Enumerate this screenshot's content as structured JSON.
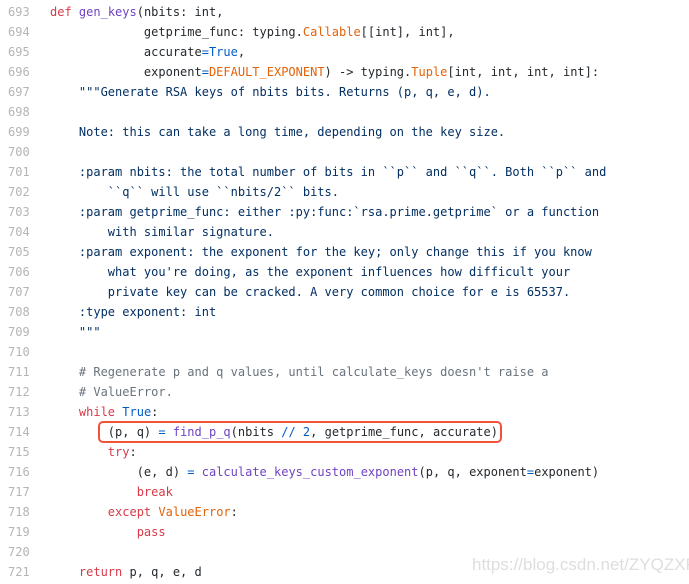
{
  "code": {
    "lines": [
      {
        "n": "693",
        "tokens": [
          [
            "kw",
            "def"
          ],
          [
            "tx",
            " "
          ],
          [
            "fn",
            "gen_keys"
          ],
          [
            "tx",
            "(nbits: int,"
          ]
        ]
      },
      {
        "n": "694",
        "tokens": [
          [
            "tx",
            "             getprime_func: typing."
          ],
          [
            "bi",
            "Callable"
          ],
          [
            "tx",
            "[[int], int],"
          ]
        ]
      },
      {
        "n": "695",
        "tokens": [
          [
            "tx",
            "             accurate"
          ],
          [
            "op",
            "="
          ],
          [
            "const",
            "True"
          ],
          [
            "tx",
            ","
          ]
        ]
      },
      {
        "n": "696",
        "tokens": [
          [
            "tx",
            "             exponent"
          ],
          [
            "op",
            "="
          ],
          [
            "bi",
            "DEFAULT_EXPONENT"
          ],
          [
            "tx",
            ") -> typing."
          ],
          [
            "bi",
            "Tuple"
          ],
          [
            "tx",
            "[int, int, int, int]:"
          ]
        ]
      },
      {
        "n": "697",
        "tokens": [
          [
            "str",
            "    \"\"\"Generate RSA keys of nbits bits. Returns (p, q, e, d)."
          ]
        ]
      },
      {
        "n": "698",
        "tokens": []
      },
      {
        "n": "699",
        "tokens": [
          [
            "str",
            "    Note: this can take a long time, depending on the key size."
          ]
        ]
      },
      {
        "n": "700",
        "tokens": []
      },
      {
        "n": "701",
        "tokens": [
          [
            "str",
            "    :param nbits: the total number of bits in ``p`` and ``q``. Both ``p`` and"
          ]
        ]
      },
      {
        "n": "702",
        "tokens": [
          [
            "str",
            "        ``q`` will use ``nbits/2`` bits."
          ]
        ]
      },
      {
        "n": "703",
        "tokens": [
          [
            "str",
            "    :param getprime_func: either :py:func:`rsa.prime.getprime` or a function"
          ]
        ]
      },
      {
        "n": "704",
        "tokens": [
          [
            "str",
            "        with similar signature."
          ]
        ]
      },
      {
        "n": "705",
        "tokens": [
          [
            "str",
            "    :param exponent: the exponent for the key; only change this if you know"
          ]
        ]
      },
      {
        "n": "706",
        "tokens": [
          [
            "str",
            "        what you're doing, as the exponent influences how difficult your"
          ]
        ]
      },
      {
        "n": "707",
        "tokens": [
          [
            "str",
            "        private key can be cracked. A very common choice for e is 65537."
          ]
        ]
      },
      {
        "n": "708",
        "tokens": [
          [
            "str",
            "    :type exponent: int"
          ]
        ]
      },
      {
        "n": "709",
        "tokens": [
          [
            "str",
            "    \"\"\""
          ]
        ]
      },
      {
        "n": "710",
        "tokens": []
      },
      {
        "n": "711",
        "tokens": [
          [
            "cm",
            "    # Regenerate p and q values, until calculate_keys doesn't raise a"
          ]
        ]
      },
      {
        "n": "712",
        "tokens": [
          [
            "cm",
            "    # ValueError."
          ]
        ]
      },
      {
        "n": "713",
        "tokens": [
          [
            "kw",
            "    while"
          ],
          [
            "tx",
            " "
          ],
          [
            "const",
            "True"
          ],
          [
            "tx",
            ":"
          ]
        ]
      },
      {
        "n": "714",
        "tokens": [
          [
            "tx",
            "        (p, q) "
          ],
          [
            "op",
            "="
          ],
          [
            "tx",
            " "
          ],
          [
            "fn",
            "find_p_q"
          ],
          [
            "tx",
            "(nbits "
          ],
          [
            "op",
            "//"
          ],
          [
            "tx",
            " "
          ],
          [
            "const",
            "2"
          ],
          [
            "tx",
            ", getprime_func, accurate)"
          ]
        ]
      },
      {
        "n": "715",
        "tokens": [
          [
            "kw",
            "        try"
          ],
          [
            "tx",
            ":"
          ]
        ]
      },
      {
        "n": "716",
        "tokens": [
          [
            "tx",
            "            (e, d) "
          ],
          [
            "op",
            "="
          ],
          [
            "tx",
            " "
          ],
          [
            "fn",
            "calculate_keys_custom_exponent"
          ],
          [
            "tx",
            "(p, q, exponent"
          ],
          [
            "op",
            "="
          ],
          [
            "tx",
            "exponent)"
          ]
        ]
      },
      {
        "n": "717",
        "tokens": [
          [
            "kw",
            "            break"
          ]
        ]
      },
      {
        "n": "718",
        "tokens": [
          [
            "kw",
            "        except"
          ],
          [
            "tx",
            " "
          ],
          [
            "bi",
            "ValueError"
          ],
          [
            "tx",
            ":"
          ]
        ]
      },
      {
        "n": "719",
        "tokens": [
          [
            "kw",
            "            pass"
          ]
        ]
      },
      {
        "n": "720",
        "tokens": []
      },
      {
        "n": "721",
        "tokens": [
          [
            "kw",
            "    return"
          ],
          [
            "tx",
            " p, q, e, d"
          ]
        ]
      }
    ],
    "highlighted_line": "714",
    "highlight_color": "#f0533a"
  },
  "watermark": "https://blog.csdn.net/ZYQZXF",
  "colors": {
    "keyword": "#d73a49",
    "function": "#6f42c1",
    "builtin": "#e36209",
    "constant": "#005cc5",
    "docstring": "#032f62",
    "comment": "#6a737d",
    "text": "#24292e"
  }
}
